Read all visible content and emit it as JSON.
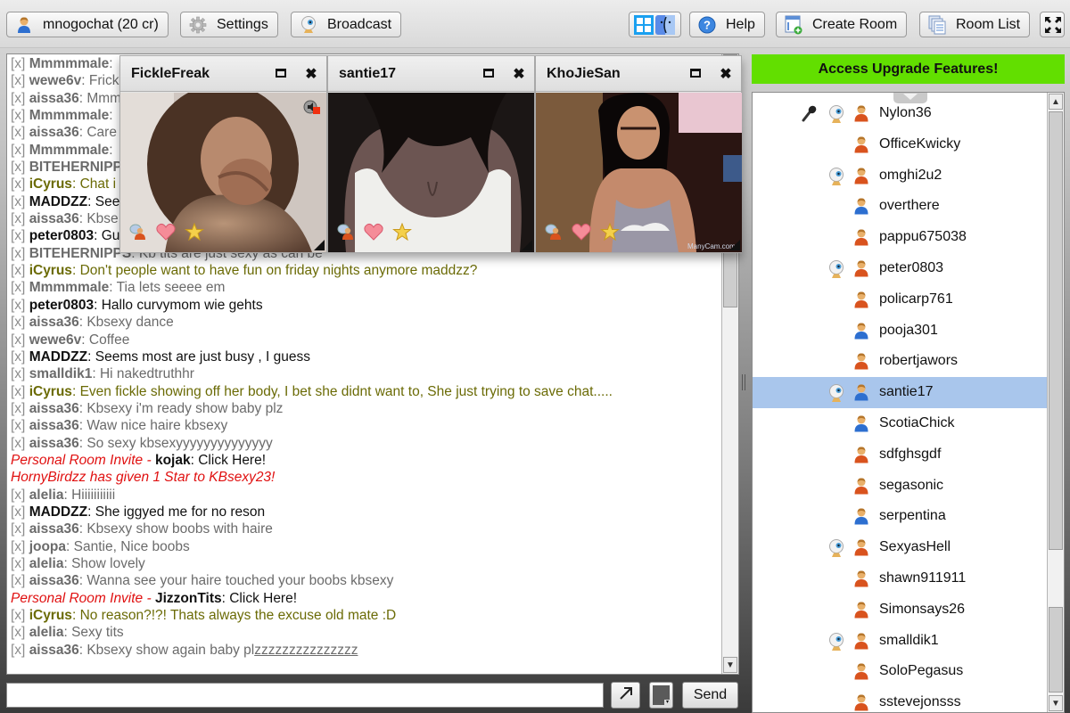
{
  "toolbar": {
    "account_label": "mnogochat (20 cr)",
    "settings_label": "Settings",
    "broadcast_label": "Broadcast",
    "help_label": "Help",
    "create_room_label": "Create Room",
    "room_list_label": "Room List"
  },
  "chat": {
    "close_marker": "[x]",
    "lines": [
      {
        "type": "msg",
        "style": "gray",
        "name": "Mmmmmale",
        "text": ""
      },
      {
        "type": "msg",
        "style": "gray",
        "name": "wewe6v",
        "text": "Frick"
      },
      {
        "type": "msg",
        "style": "gray",
        "name": "aissa36",
        "text": "Mmm"
      },
      {
        "type": "msg",
        "style": "gray",
        "name": "Mmmmmale",
        "text": ""
      },
      {
        "type": "msg",
        "style": "gray",
        "name": "aissa36",
        "text": "Care"
      },
      {
        "type": "msg",
        "style": "gray",
        "name": "Mmmmmale",
        "text": ""
      },
      {
        "type": "msg",
        "style": "gray",
        "name": "BITEHERNIPPLES",
        "text": ""
      },
      {
        "type": "msg",
        "style": "olive",
        "name": "iCyrus",
        "text": "Chat i"
      },
      {
        "type": "msg",
        "style": "black",
        "name": "MADDZZ",
        "text": "See"
      },
      {
        "type": "msg",
        "style": "gray",
        "name": "aissa36",
        "text": "Kbse"
      },
      {
        "type": "msg",
        "style": "black",
        "name": "peter0803",
        "text": "Gu"
      },
      {
        "type": "msg",
        "style": "gray",
        "name": "BITEHERNIPPS",
        "text": "Kb tits are just sexy as can be"
      },
      {
        "type": "msg",
        "style": "olive",
        "name": "iCyrus",
        "text": "Don't people want to have fun on friday nights anymore maddzz?"
      },
      {
        "type": "msg",
        "style": "gray",
        "name": "Mmmmmale",
        "text": "Tia lets seeee em"
      },
      {
        "type": "msg",
        "style": "black",
        "name": "peter0803",
        "text": "Hallo curvymom wie gehts"
      },
      {
        "type": "msg",
        "style": "gray",
        "name": "aissa36",
        "text": "Kbsexy dance"
      },
      {
        "type": "msg",
        "style": "gray",
        "name": "wewe6v",
        "text": "Coffee"
      },
      {
        "type": "msg",
        "style": "black",
        "name": "MADDZZ",
        "text": "Seems most are just busy , I guess"
      },
      {
        "type": "msg",
        "style": "gray",
        "name": "smalldik1",
        "text": "Hi nakedtruthhr"
      },
      {
        "type": "msg",
        "style": "olive",
        "name": "iCyrus",
        "text": "Even fickle showing off her body, I bet she didnt want to, She just trying to save chat....."
      },
      {
        "type": "msg",
        "style": "gray",
        "name": "aissa36",
        "text": "Kbsexy i'm ready show baby plz"
      },
      {
        "type": "msg",
        "style": "gray",
        "name": "aissa36",
        "text": "Waw nice haire kbsexy"
      },
      {
        "type": "msg",
        "style": "gray",
        "name": "aissa36",
        "text": "So sexy kbsexyyyyyyyyyyyyyy"
      },
      {
        "type": "invite",
        "prefix": "Personal Room Invite - ",
        "name": "kojak",
        "text": "Click Here!"
      },
      {
        "type": "notice",
        "text": "HornyBirdzz has given 1 Star to KBsexy23!"
      },
      {
        "type": "msg",
        "style": "gray",
        "name": "alelia",
        "text": "Hiiiiiiiiiii"
      },
      {
        "type": "msg",
        "style": "black",
        "name": "MADDZZ",
        "text": "She iggyed me for no reson"
      },
      {
        "type": "msg",
        "style": "gray",
        "name": "aissa36",
        "text": "Kbsexy show boobs with haire"
      },
      {
        "type": "msg",
        "style": "gray",
        "name": "joopa",
        "text": "Santie, Nice boobs"
      },
      {
        "type": "msg",
        "style": "gray",
        "name": "alelia",
        "text": "Show lovely"
      },
      {
        "type": "msg",
        "style": "gray",
        "name": "aissa36",
        "text": "Wanna see your haire touched your boobs kbsexy"
      },
      {
        "type": "invite",
        "prefix": "Personal Room Invite - ",
        "name": "JizzonTits",
        "text": "Click Here!"
      },
      {
        "type": "msg",
        "style": "olive",
        "name": "iCyrus",
        "text": "No reason?!?! Thats always the excuse old mate :D"
      },
      {
        "type": "msg",
        "style": "gray",
        "name": "alelia",
        "text": "Sexy tits"
      },
      {
        "type": "msg",
        "style": "gray",
        "name": "aissa36",
        "text": "Kbsexy show again baby pl",
        "underlined": "zzzzzzzzzzzzzzz"
      }
    ]
  },
  "cams": [
    {
      "name": "FickleFreak",
      "scene": "fickle"
    },
    {
      "name": "santie17",
      "scene": "santie"
    },
    {
      "name": "KhoJieSan",
      "scene": "khojie",
      "watermark": "ManyCam.com"
    }
  ],
  "input": {
    "value": "",
    "placeholder": "",
    "send_label": "Send"
  },
  "upgrade_label": "Access Upgrade Features!",
  "users": [
    {
      "name": "Nylon36",
      "mic": true,
      "cam": true,
      "gender": "male"
    },
    {
      "name": "OfficeKwicky",
      "mic": false,
      "cam": false,
      "gender": "male"
    },
    {
      "name": "omghi2u2",
      "mic": false,
      "cam": true,
      "gender": "male"
    },
    {
      "name": "overthere",
      "mic": false,
      "cam": false,
      "gender": "female"
    },
    {
      "name": "pappu675038",
      "mic": false,
      "cam": false,
      "gender": "male"
    },
    {
      "name": "peter0803",
      "mic": false,
      "cam": true,
      "gender": "male"
    },
    {
      "name": "policarp761",
      "mic": false,
      "cam": false,
      "gender": "male"
    },
    {
      "name": "pooja301",
      "mic": false,
      "cam": false,
      "gender": "female"
    },
    {
      "name": "robertjawors",
      "mic": false,
      "cam": false,
      "gender": "male"
    },
    {
      "name": "santie17",
      "mic": false,
      "cam": true,
      "gender": "female",
      "selected": true
    },
    {
      "name": "ScotiaChick",
      "mic": false,
      "cam": false,
      "gender": "female"
    },
    {
      "name": "sdfghsgdf",
      "mic": false,
      "cam": false,
      "gender": "male"
    },
    {
      "name": "segasonic",
      "mic": false,
      "cam": false,
      "gender": "male"
    },
    {
      "name": "serpentina",
      "mic": false,
      "cam": false,
      "gender": "female"
    },
    {
      "name": "SexyasHell",
      "mic": false,
      "cam": true,
      "gender": "male"
    },
    {
      "name": "shawn911911",
      "mic": false,
      "cam": false,
      "gender": "male"
    },
    {
      "name": "Simonsays26",
      "mic": false,
      "cam": false,
      "gender": "male"
    },
    {
      "name": "smalldik1",
      "mic": false,
      "cam": true,
      "gender": "male"
    },
    {
      "name": "SoloPegasus",
      "mic": false,
      "cam": false,
      "gender": "male"
    },
    {
      "name": "sstevejonsss",
      "mic": false,
      "cam": false,
      "gender": "male"
    }
  ],
  "colors": {
    "upgrade_bg": "#62df00",
    "selected_row": "#a9c6ec",
    "system_text": "#e01010",
    "icyrus_text": "#6b6b06"
  }
}
